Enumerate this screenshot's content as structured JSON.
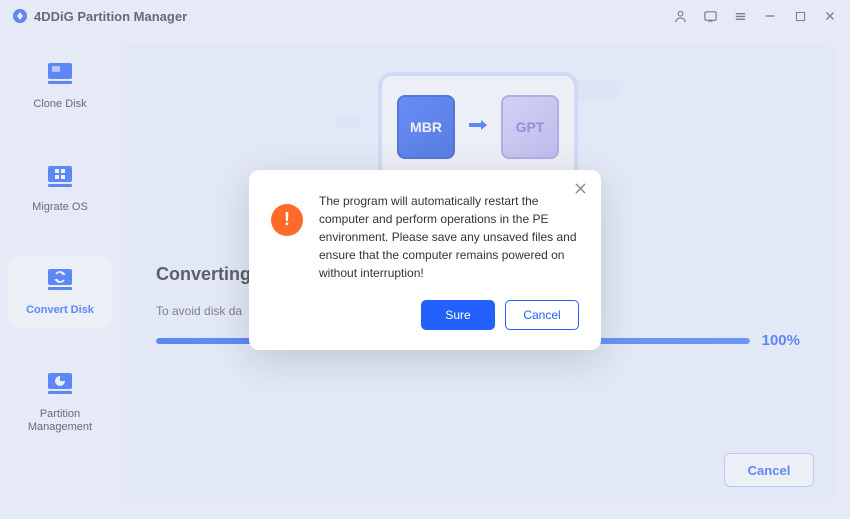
{
  "app": {
    "title": "4DDiG Partition Manager"
  },
  "titlebar": {
    "icons": [
      "user-icon",
      "feedback-icon",
      "menu-icon",
      "minimize-icon",
      "maximize-icon",
      "close-icon"
    ]
  },
  "sidebar": {
    "items": [
      {
        "label": "Clone Disk",
        "icon": "clone-disk-icon",
        "active": false
      },
      {
        "label": "Migrate OS",
        "icon": "migrate-os-icon",
        "active": false
      },
      {
        "label": "Convert Disk",
        "icon": "convert-disk-icon",
        "active": true
      },
      {
        "label": "Partition Management",
        "icon": "partition-mgmt-icon",
        "active": false
      }
    ]
  },
  "illustration": {
    "source_label": "MBR",
    "target_label": "GPT"
  },
  "progress": {
    "title": "Converting",
    "subtitle": "To avoid disk da",
    "percent_label": "100%",
    "percent_value": 100
  },
  "actions": {
    "main_cancel": "Cancel"
  },
  "dialog": {
    "message": "The program will automatically restart the computer and perform operations in the PE environment. Please save any unsaved files and ensure that the computer remains powered on without interruption!",
    "sure_label": "Sure",
    "cancel_label": "Cancel"
  }
}
